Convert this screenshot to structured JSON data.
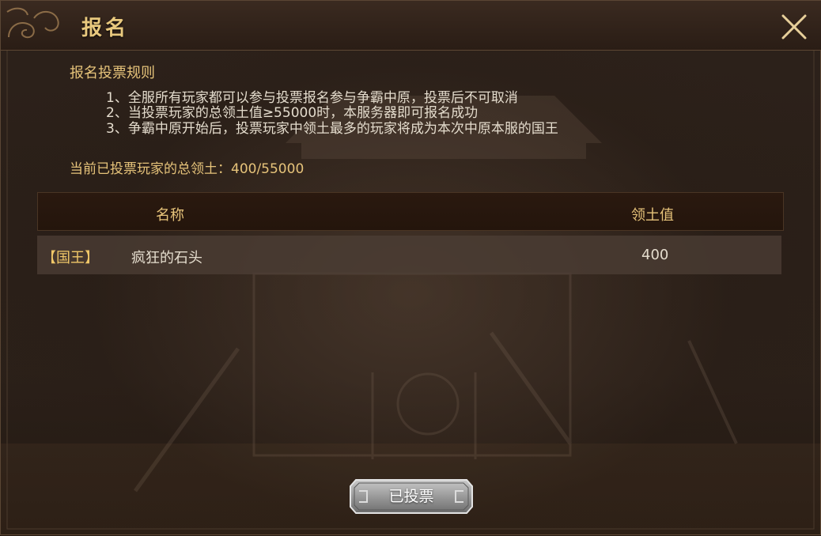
{
  "dialog": {
    "title": "报名",
    "rules_title": "报名投票规则",
    "rules": [
      "1、全服所有玩家都可以参与投票报名参与争霸中原，投票后不可取消",
      "2、当投票玩家的总领土值≥55000时，本服务器即可报名成功",
      "3、争霸中原开始后，投票玩家中领土最多的玩家将成为本次中原本服的国王"
    ],
    "total_label": "当前已投票玩家的总领土：400/55000",
    "table": {
      "headers": [
        "名称",
        "领土值"
      ],
      "rows": [
        {
          "tag": "【国王】",
          "name": "疯狂的石头",
          "value": "400"
        }
      ]
    },
    "vote_button_label": "已投票"
  },
  "icons": {
    "close": "close-icon",
    "title_ornament": "cloud-scroll-ornament"
  },
  "colors": {
    "gold_text": "#e6c37a",
    "body_text": "#e4dccd",
    "tag_text": "#f0c768"
  }
}
